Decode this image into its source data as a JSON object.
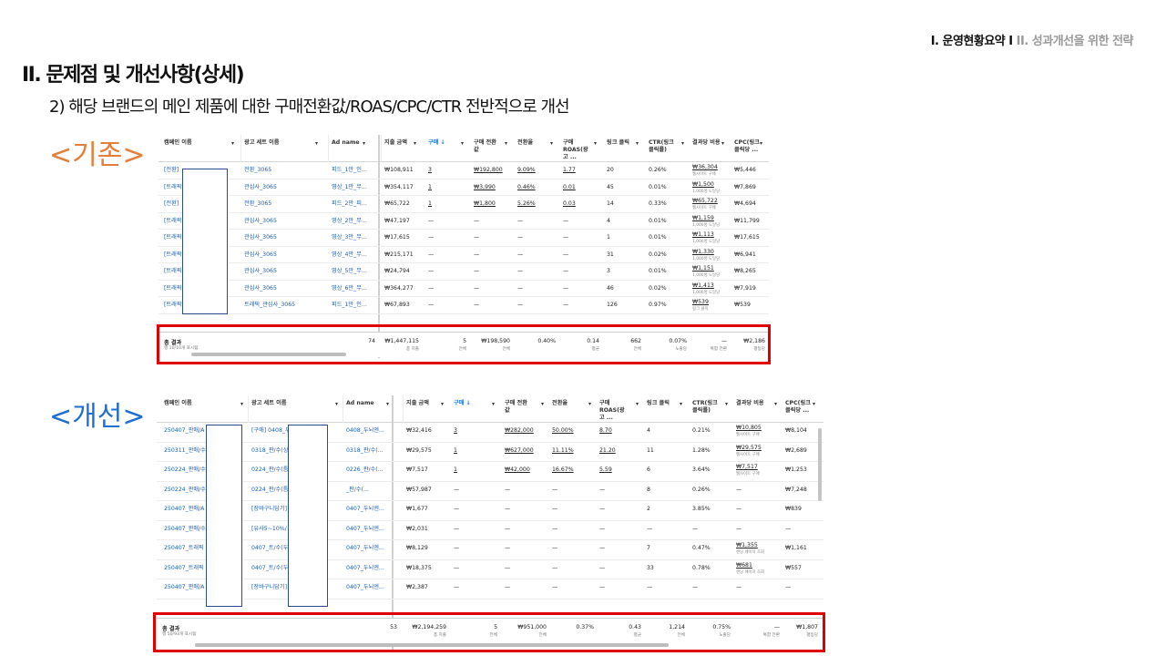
{
  "breadcrumb": {
    "active": "I. 운영현황요약 I",
    "inactive": " II. 성과개선을 위한 전략"
  },
  "title": "II. 문제점 및 개선사항(상세)",
  "subtitle": "2) 해당 브랜드의 메인 제품에 대한 구매전환값/ROAS/CPC/CTR 전반적으로 개선",
  "label_before": "<기존>",
  "label_after": "<개선>",
  "colors": {
    "highlight": "#e00000",
    "orange": "#e67e3a",
    "blue": "#1f6fd1",
    "link": "#1a5fb4"
  },
  "table_before": {
    "headers": [
      "캠페인 이름",
      "광고 세트 이름",
      "Ad name",
      "지출 금액",
      "구매 ↓",
      "구매 전환값",
      "전환율",
      "구매 ROAS(광고 ...",
      "링크 클릭",
      "CTR(링크 클릭률)",
      "결과당 비용",
      "CPC(링크 클릭당 ..."
    ],
    "rows": [
      {
        "c1": "[전환]",
        "c2": "전환_3065",
        "c3": "피드_1만_인...",
        "spend": "₩108,911",
        "buy": "3",
        "value": "₩192,800",
        "cvr": "9.09%",
        "roas": "1.77",
        "clicks": "20",
        "ctr": "0.26%",
        "cpr": "₩36,304",
        "cpr_sub": "웹사이트 구매",
        "cpc": "₩5,446"
      },
      {
        "c1": "[트래픽",
        "c2": "관심사_3065",
        "c3": "영상_1만_무...",
        "spend": "₩354,117",
        "buy": "1",
        "value": "₩3,990",
        "cvr": "0.46%",
        "roas": "0.01",
        "clicks": "45",
        "ctr": "0.01%",
        "cpr": "₩1,500",
        "cpr_sub": "1,000명 도달당",
        "cpc": "₩7,869"
      },
      {
        "c1": "[전환]",
        "c2": "전환_3065",
        "c3": "피드_2만_피...",
        "spend": "₩65,722",
        "buy": "1",
        "value": "₩1,800",
        "cvr": "5.26%",
        "roas": "0.03",
        "clicks": "14",
        "ctr": "0.33%",
        "cpr": "₩65,722",
        "cpr_sub": "웹사이트 구매",
        "cpc": "₩4,694"
      },
      {
        "c1": "[트래픽",
        "c2": "관심사_3065",
        "c3": "영상_2만_무...",
        "spend": "₩47,197",
        "buy": "—",
        "value": "—",
        "cvr": "—",
        "roas": "—",
        "clicks": "4",
        "ctr": "0.01%",
        "cpr": "₩1,159",
        "cpr_sub": "1,000명 도달당",
        "cpc": "₩11,799"
      },
      {
        "c1": "[트래픽",
        "c2": "관심사_3065",
        "c3": "영상_3만_무...",
        "spend": "₩17,615",
        "buy": "—",
        "value": "—",
        "cvr": "—",
        "roas": "—",
        "clicks": "1",
        "ctr": "0.01%",
        "cpr": "₩1,113",
        "cpr_sub": "1,000명 도달당",
        "cpc": "₩17,615"
      },
      {
        "c1": "[트래픽",
        "c2": "관심사_3065",
        "c3": "영상_4만_무...",
        "spend": "₩215,171",
        "buy": "—",
        "value": "—",
        "cvr": "—",
        "roas": "—",
        "clicks": "31",
        "ctr": "0.02%",
        "cpr": "₩1,330",
        "cpr_sub": "1,000명 도달당",
        "cpc": "₩6,941"
      },
      {
        "c1": "[트래픽",
        "c2": "관심사_3065",
        "c3": "영상_5만_무...",
        "spend": "₩24,794",
        "buy": "—",
        "value": "—",
        "cvr": "—",
        "roas": "—",
        "clicks": "3",
        "ctr": "0.01%",
        "cpr": "₩1,151",
        "cpr_sub": "1,000명 도달당",
        "cpc": "₩8,265"
      },
      {
        "c1": "[트래픽",
        "c2": "관심사_3065",
        "c3": "영상_6만_무...",
        "spend": "₩364,277",
        "buy": "—",
        "value": "—",
        "cvr": "—",
        "roas": "—",
        "clicks": "46",
        "ctr": "0.02%",
        "cpr": "₩1,413",
        "cpr_sub": "1,000명 도달당",
        "cpc": "₩7,919"
      },
      {
        "c1": "[트래픽",
        "c2": "트래픽_관심사_3065",
        "c3": "피드_1만_인...",
        "spend": "₩67,893",
        "buy": "—",
        "value": "—",
        "cvr": "—",
        "roas": "—",
        "clicks": "126",
        "ctr": "0.97%",
        "cpr": "₩539",
        "cpr_sub": "링크 클릭",
        "cpc": "₩539"
      }
    ],
    "total": {
      "title": "총 결과",
      "sub": "행 10/10개 표시됨",
      "spend": "₩1,447,115",
      "spend_l": "총 지출",
      "buy": "5",
      "buy_l": "전체",
      "value": "₩198,590",
      "value_l": "전체",
      "cvr": "0.40%",
      "roas": "0.14",
      "roas_l": "평균",
      "clicks": "662",
      "clicks_l": "전체",
      "ctr": "0.07%",
      "ctr_l": "노출당",
      "cpr": "—",
      "cpr_l": "복합 전환",
      "cpc": "₩2,186",
      "cpc_l": "평등당",
      "cut": "74"
    }
  },
  "table_after": {
    "headers": [
      "캠페인 이름",
      "광고 세트 이름",
      "Ad name",
      "지출 금액",
      "구매 ↓",
      "구매 전환값",
      "전환율",
      "구매 ROAS(광고 ...",
      "링크 클릭",
      "CTR(링크 클릭률)",
      "결과당 비용",
      "CPC(링크 클릭당 ..."
    ],
    "rows": [
      {
        "c1": "250407_판매/A",
        "c2": "[구매] 0408_두",
        "c3": "0408_두뇌엔...",
        "spend": "₩32,416",
        "buy": "3",
        "value": "₩282,000",
        "cvr": "50.00%",
        "roas": "8.70",
        "clicks": "4",
        "ctr": "0.21%",
        "cpr": "₩10,805",
        "cpr_sub": "웹사이트 구매",
        "cpc": "₩8,104"
      },
      {
        "c1": "250311_판매/수",
        "c2": "0318_판/수(상",
        "c3": "0318_판/수(...",
        "spend": "₩29,575",
        "buy": "1",
        "value": "₩627,000",
        "cvr": "11.11%",
        "roas": "21.20",
        "clicks": "11",
        "ctr": "1.28%",
        "cpr": "₩29,575",
        "cpr_sub": "웹사이트 구매",
        "cpc": "₩2,689"
      },
      {
        "c1": "250224_판매/수",
        "c2": "0224_판/수(틈",
        "c3": "0226_판/수(...",
        "spend": "₩7,517",
        "buy": "1",
        "value": "₩42,000",
        "cvr": "16.67%",
        "roas": "5.59",
        "clicks": "6",
        "ctr": "3.64%",
        "cpr": "₩7,517",
        "cpr_sub": "웹사이트 구매",
        "cpc": "₩1,253"
      },
      {
        "c1": "250224_판매/수",
        "c2": "0224_판/수(틈",
        "c3": "_판/수(...",
        "spend": "₩57,987",
        "buy": "—",
        "value": "—",
        "cvr": "—",
        "roas": "—",
        "clicks": "8",
        "ctr": "0.26%",
        "cpr": "—",
        "cpr_sub": "",
        "cpc": "₩7,248"
      },
      {
        "c1": "250407_판매/A",
        "c2": "[장바구니담기]",
        "c3": "0407_두뇌엔...",
        "spend": "₩1,677",
        "buy": "—",
        "value": "—",
        "cvr": "—",
        "roas": "—",
        "clicks": "2",
        "ctr": "3.85%",
        "cpr": "—",
        "cpr_sub": "",
        "cpc": "₩839"
      },
      {
        "c1": "250407_판매/수",
        "c2": "[유사5~10%/",
        "c3": "0407_두뇌엔...",
        "spend": "₩2,031",
        "buy": "—",
        "value": "—",
        "cvr": "—",
        "roas": "—",
        "clicks": "—",
        "ctr": "—",
        "cpr": "—",
        "cpr_sub": "",
        "cpc": "—"
      },
      {
        "c1": "250407_트래픽",
        "c2": "0407_트/수(두",
        "c3": "0407_두뇌엔...",
        "spend": "₩8,129",
        "buy": "—",
        "value": "—",
        "cvr": "—",
        "roas": "—",
        "clicks": "7",
        "ctr": "0.47%",
        "cpr": "₩1,355",
        "cpr_sub": "랜딩 페이지 조회",
        "cpc": "₩1,161"
      },
      {
        "c1": "250407_트래픽",
        "c2": "0407_트/수(두",
        "c3": "0407_두뇌엔...",
        "spend": "₩18,375",
        "buy": "—",
        "value": "—",
        "cvr": "—",
        "roas": "—",
        "clicks": "33",
        "ctr": "0.78%",
        "cpr": "₩681",
        "cpr_sub": "랜딩 페이지 조회",
        "cpc": "₩557"
      },
      {
        "c1": "250407_판매/A",
        "c2": "[장바구니담기]",
        "c3": "0407_두뇌엔...",
        "spend": "₩2,387",
        "buy": "—",
        "value": "—",
        "cvr": "—",
        "roas": "—",
        "clicks": "—",
        "ctr": "—",
        "cpr": "—",
        "cpr_sub": "",
        "cpc": "—"
      }
    ],
    "total": {
      "title": "총 결과",
      "sub": "행 50/93개 표시됨",
      "spend": "₩2,194,259",
      "spend_l": "총 지출",
      "buy": "5",
      "buy_l": "전체",
      "value": "₩951,000",
      "value_l": "전체",
      "cvr": "0.37%",
      "roas": "0.43",
      "roas_l": "평균",
      "clicks": "1,214",
      "clicks_l": "전체",
      "ctr": "0.75%",
      "ctr_l": "노출당",
      "cpr": "—",
      "cpr_l": "복합 전환",
      "cpc": "₩1,807",
      "cpc_l": "평등당",
      "cut": "53"
    }
  }
}
